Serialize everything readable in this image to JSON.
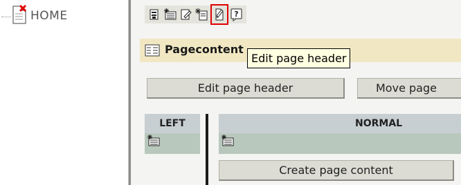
{
  "tree": {
    "label": "HOME"
  },
  "toolbar": {
    "icons": [
      "page-properties-icon",
      "new-content-icon",
      "edit-page-icon",
      "new-page-icon",
      "edit-header-icon",
      "help-icon"
    ]
  },
  "header": {
    "title": "Pagecontent"
  },
  "tooltip": {
    "text": "Edit page header"
  },
  "buttons": {
    "edit_header": "Edit page header",
    "move_page": "Move page"
  },
  "columns": [
    {
      "label": "LEFT"
    },
    {
      "label": "NORMAL"
    }
  ],
  "create_button": "Create page content",
  "colors": {
    "header_bar": "#f1e8c3",
    "col_body": "#b8c8bd",
    "col_head": "#c8cfd2",
    "highlight": "#e00000"
  }
}
